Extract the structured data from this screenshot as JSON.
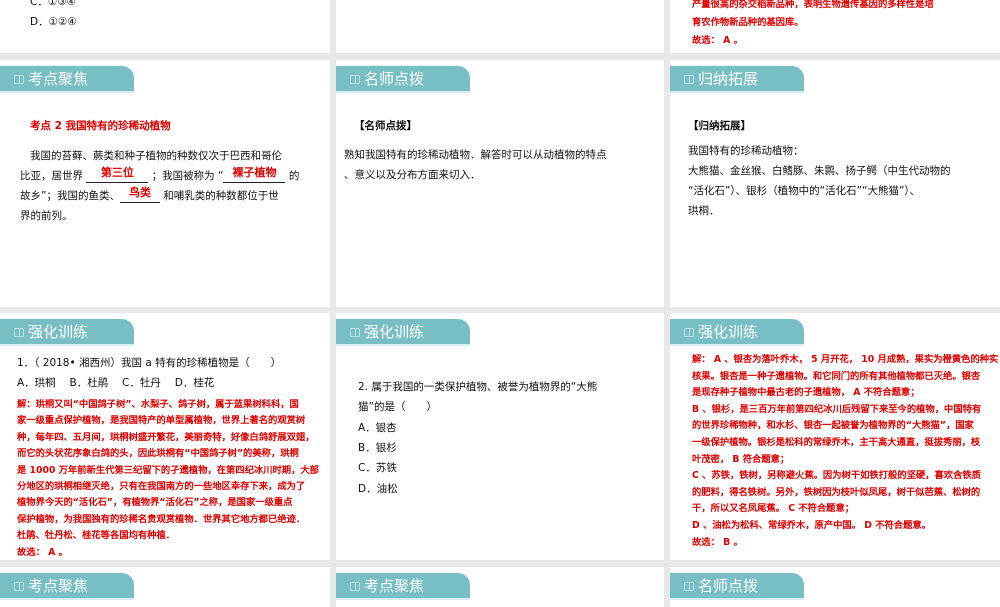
{
  "row0": {
    "left": {
      "lines": [
        "C．①③④",
        "D．①②④"
      ]
    },
    "right": {
      "lines": [
        "产量很高的杂交稻新品种，表明生物遗传基因的多样性是培",
        "育农作物新品种的基因库。",
        "故选： A 。"
      ]
    }
  },
  "row1": {
    "s1": {
      "tab": "考点聚焦",
      "title": "考点 2   我国特有的珍稀动植物",
      "p1": "我国的苔藓、蕨类和种子植物的种数仅次于巴西和哥伦",
      "p2a": "比亚，居世界",
      "blank1": "第三位",
      "p2b": "；我国被称为 “",
      "blank2": "裸子植物",
      "p2c": "的",
      "p3a": "故乡”；我国的鱼类、",
      "blank3": "鸟类",
      "p3b": "和哺乳类的种数都位于世",
      "p4": "界的前列。"
    },
    "s2": {
      "tab": "名师点拨",
      "heading": "【名师点拨】",
      "lines": [
        "熟知我国特有的珍稀动植物．解答时可以从动植物的特点",
        "、意义以及分布方面来切入．"
      ]
    },
    "s3": {
      "tab": "归纳拓展",
      "heading": "【归纳拓展】",
      "lines": [
        "我国特有的珍稀动植物：",
        "大熊猫、金丝猴、白鳍豚、朱鹮、扬子鳄（中生代动物的",
        "“活化石”）、银杉（植物中的“活化石”“大熊猫”）、",
        "珙桐．"
      ]
    }
  },
  "row2": {
    "s1": {
      "tab": "强化训练",
      "question": "1．（ 2018• 湘西州）我国 a 特有的珍稀植物是（　　）",
      "options": "A．珙桐　 B．杜鹃　 C．牡丹　 D．桂花",
      "answer": [
        "解：珙桐又叫“中国鸽子树”、水梨子、鸽子树，属于蓝果树科科，国",
        "家一级重点保护植物，是我国特产的单型属植物，世界上著名的观赏树",
        "种，每年四、五月间，珙桐树盛开繁花，美丽奇特，好像白鸽舒展双翅，",
        "而它的头状花序象白鸽的头，因此珙桐有“中国鸽子树”的美称，珙桐",
        "是 1000 万年前新生代第三纪留下的孑遗植物，在第四纪冰川时期，大部",
        "分地区的珙桐相继灭绝，只有在我国南方的一些地区幸存下来，成为了",
        "植物界今天的“活化石”，有植物界“活化石”之称，是国家一级重点",
        "保护植物，为我国独有的珍稀名贵观赏植物．世界其它地方都已绝迹．",
        "杜鹃、牡丹松、桂花等各国均有种植．",
        "故选： A 。"
      ]
    },
    "s2": {
      "tab": "强化训练",
      "lines": [
        "2. 属于我国的一类保护植物、被誉为植物界的“大熊",
        "猫”的是（　　）",
        "A．银杏",
        "B．银杉",
        "C．苏铁",
        "D．油松"
      ]
    },
    "s3": {
      "tab": "强化训练",
      "answer": [
        "解： A 、银杏为落叶乔木， 5 月开花， 10 月成熟，果实为橙黄色的种实",
        "核果。银杏是一种子遗植物。和它同门的所有其他植物都已灭绝。银杏",
        "是现存种子植物中最古老的子遗植物， A 不符合题意；",
        "B 、银杉，是三百万年前第四纪冰川后残留下来至今的植物，中国特有",
        "的世界珍稀物种，和水杉、银杏一起被誉为植物界的“大熊猫”，国家",
        "一级保护植物。银杉是松科的常绿乔木，主干高大通直，挺拔秀丽，枝",
        "叶茂密， B 符合题意；",
        "C 、苏铁，铁树，另称避火蕉。因为树干如铁打般的坚硬，喜欢含铁质",
        "的肥料，得名铁树。另外，铁树因为枝叶似凤尾，树干似芭蕉、松树的",
        "干，所以又名凤尾蕉。 C 不符合题意；",
        "D 、油松为松科、常绿乔木，原产中国。 D 不符合题意。",
        "故选： B 。"
      ]
    }
  },
  "row3": {
    "s1": {
      "tab": "考点聚焦"
    },
    "s2": {
      "tab": "考点聚焦"
    },
    "s3": {
      "tab": "名师点拨"
    }
  },
  "colors": {
    "tab": "#77bfc5",
    "answer_red": "#e00000",
    "gap": "#e8e8e8"
  }
}
